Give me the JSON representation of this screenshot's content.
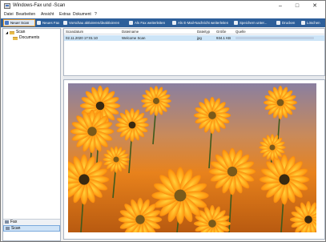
{
  "window": {
    "title": "Windows-Fax und -Scan",
    "controls": {
      "minimize": "–",
      "maximize": "□",
      "close": "✕"
    }
  },
  "menu": [
    "Datei",
    "Bearbeiten",
    "Ansicht",
    "Extras",
    "Dokument",
    "?"
  ],
  "toolbar": {
    "buttons": [
      {
        "label": "Neuer Scan",
        "icon": "scanner-icon"
      },
      {
        "label": "Neues Fax",
        "icon": "fax-icon"
      },
      {
        "label": "Vorschau aktivieren/deaktivieren",
        "icon": "preview-icon"
      },
      {
        "label": "Als Fax weiterleiten",
        "icon": "forward-fax-icon"
      },
      {
        "label": "Als E-Mail-Nachricht weiterleiten",
        "icon": "forward-mail-icon"
      },
      {
        "label": "Speichern unter...",
        "icon": "save-icon"
      },
      {
        "label": "Drucken",
        "icon": "print-icon"
      },
      {
        "label": "Löschen",
        "icon": "delete-icon"
      }
    ]
  },
  "sidebar": {
    "root": "Scan",
    "child": "Documents",
    "nav": [
      {
        "label": "Fax",
        "selected": false
      },
      {
        "label": "Scan",
        "selected": true
      }
    ]
  },
  "list": {
    "columns": [
      "Scandatum",
      "Dateiname",
      "Dateityp",
      "Größe",
      "Quelle"
    ],
    "rows": [
      {
        "date": "02.11.2020 17:01:10",
        "name": "Welcome Scan",
        "type": "jpg",
        "size": "934.1 KB",
        "source": ""
      }
    ]
  },
  "colors": {
    "toolbar_bg": "#2d5f9a",
    "selection": "#cce4f7",
    "accent_orange": "#f0a030"
  }
}
